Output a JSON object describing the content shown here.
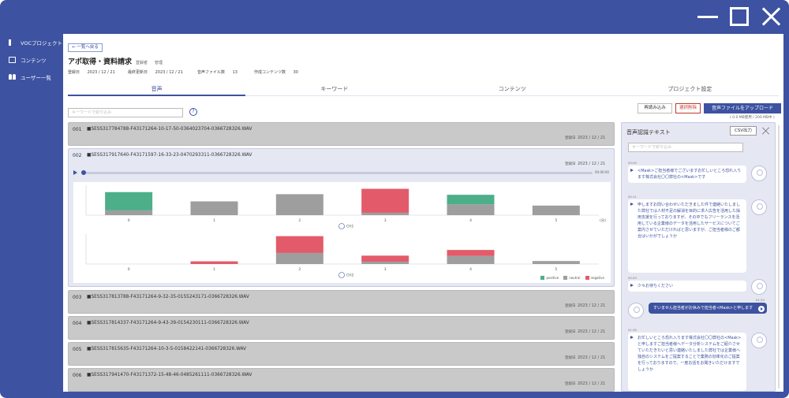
{
  "window": {
    "controls": [
      "minimize-icon",
      "maximize-icon",
      "close-icon"
    ]
  },
  "sidebar": {
    "items": [
      {
        "label": "VOCプロジェクト",
        "icon": "speaker-icon"
      },
      {
        "label": "コンテンツ",
        "icon": "document-icon"
      },
      {
        "label": "ユーザー一覧",
        "icon": "users-icon"
      }
    ]
  },
  "header": {
    "back_label": "← 一覧へ戻る",
    "title": "アポ取得・資料請求",
    "tag1": "登録者",
    "tag2": "管理",
    "meta": {
      "registered_label": "登録日",
      "registered_value": "2023 / 12 / 21",
      "updated_label": "最終更新日",
      "updated_value": "2023 / 12 / 21",
      "audio_count_label": "音声ファイル数",
      "audio_count_value": "13",
      "content_count_label": "作成コンテンツ数",
      "content_count_value": "30"
    }
  },
  "tabs": [
    {
      "label": "音声",
      "active": true
    },
    {
      "label": "キーワード",
      "active": false
    },
    {
      "label": "コンテンツ",
      "active": false
    },
    {
      "label": "プロジェクト設定",
      "active": false
    }
  ],
  "toolbar": {
    "search_placeholder": "キーワードで絞り込み",
    "help": "?",
    "select_label": "再読み込み",
    "delete_label": "選択削除",
    "upload_label": "音声ファイルをアップロード",
    "capacity": "( 0.0 MB使用 / 200 MB中 )"
  },
  "files": [
    {
      "no": "001",
      "name": "■SESS317784788-F43171264-10-17-50-0364023704-0366728326.WAV",
      "date_label": "登録日",
      "date": "2023 / 12 / 21"
    },
    {
      "no": "002",
      "name": "■SESS317917640-F43171597-16-33-23-0470293311-0366728326.WAV",
      "date_label": "登録日",
      "date": "2023 / 12 / 21",
      "expanded": true,
      "time": "00:00:00"
    },
    {
      "no": "003",
      "name": "■SESS317813788-F43171264-9-32-35-0155243171-0366728326.WAV",
      "date_label": "登録日",
      "date": "2023 / 12 / 21"
    },
    {
      "no": "004",
      "name": "■SESS317814337-F43171264-9-43-39-0154230111-0366728326.WAV",
      "date_label": "登録日",
      "date": "2023 / 12 / 21"
    },
    {
      "no": "005",
      "name": "■SESS317815635-F43171264-10-3-5-0158422141-0366728326.WAV",
      "date_label": "登録日",
      "date": "2023 / 12 / 21"
    },
    {
      "no": "006",
      "name": "■SESS317941470-F43171372-15-48-46-0485261111-0366728326.WAV",
      "date_label": "登録日",
      "date": "2023 / 12 / 21"
    }
  ],
  "chart_data": [
    {
      "type": "bar",
      "categories": [
        "0",
        "1",
        "2",
        "3",
        "4",
        "5"
      ],
      "unit": "(分)",
      "speaker_label": "CH1",
      "series": [
        {
          "name": "positive",
          "values": [
            0.61,
            0,
            0,
            0,
            0.32,
            0
          ]
        },
        {
          "name": "neutral",
          "values": [
            0.16,
            0.46,
            0.7,
            0.08,
            0.36,
            0.32
          ]
        },
        {
          "name": "negative",
          "values": [
            0,
            0,
            0,
            0.8,
            0,
            0
          ]
        }
      ],
      "ylim": [
        0,
        1
      ]
    },
    {
      "type": "bar",
      "categories": [
        "0",
        "1",
        "2",
        "3",
        "4",
        "5"
      ],
      "speaker_label": "CH2",
      "series": [
        {
          "name": "positive",
          "values": [
            0,
            0,
            0,
            0,
            0,
            0
          ]
        },
        {
          "name": "neutral",
          "values": [
            0,
            0,
            0.37,
            0.08,
            0.27,
            0.1
          ]
        },
        {
          "name": "negative",
          "values": [
            0,
            0.09,
            0.56,
            0.2,
            0.2,
            0
          ]
        }
      ],
      "ylim": [
        0,
        1
      ]
    }
  ],
  "legend": [
    {
      "name": "positive",
      "color": "#4caf8a"
    },
    {
      "name": "neutral",
      "color": "#9e9e9e"
    },
    {
      "name": "negative",
      "color": "#e35b6a"
    }
  ],
  "transcript": {
    "title": "音声認識テキスト",
    "csv_label": "CSV出力",
    "search_placeholder": "キーワードで絞り込み",
    "messages": [
      {
        "ts": "00:00",
        "side": "left",
        "text": "<Mask>ご担当者様でございますお忙しいところ恐れ入ります株式会社〇〇弊社の<Mask>です"
      },
      {
        "ts": "00:11",
        "side": "left",
        "text": "申しますお問い合わせいただきました件で連絡いたしました弊社では人材不足の解消を目的に求人広告を活用した採用支援を行っておりますが、その中でもフリーランスを活用している企業様のデータを活用したサービスについてご案内させていただければと思いますが、ご担当者様のご都合はいかがでしょうか"
      },
      {
        "ts": "00:43",
        "side": "left",
        "text": "少々お待ちください"
      },
      {
        "ts": "01:24",
        "side": "right",
        "text": "すいません担当者がお休みで担当者<Mask>と申します"
      },
      {
        "ts": "01:30",
        "side": "left",
        "text": "お忙しいところ恐れ入ります株式会社〇〇弊社の<Mask>と申しますご担当者様へデータ分析システムをご紹介させていただきたいと思い連絡いたしました弊社では企業様へ独自のシステムをご提案することで業務の効率化のご提案を行っておりますので、一度お話をお聞きいただけますでしょうか"
      }
    ]
  }
}
